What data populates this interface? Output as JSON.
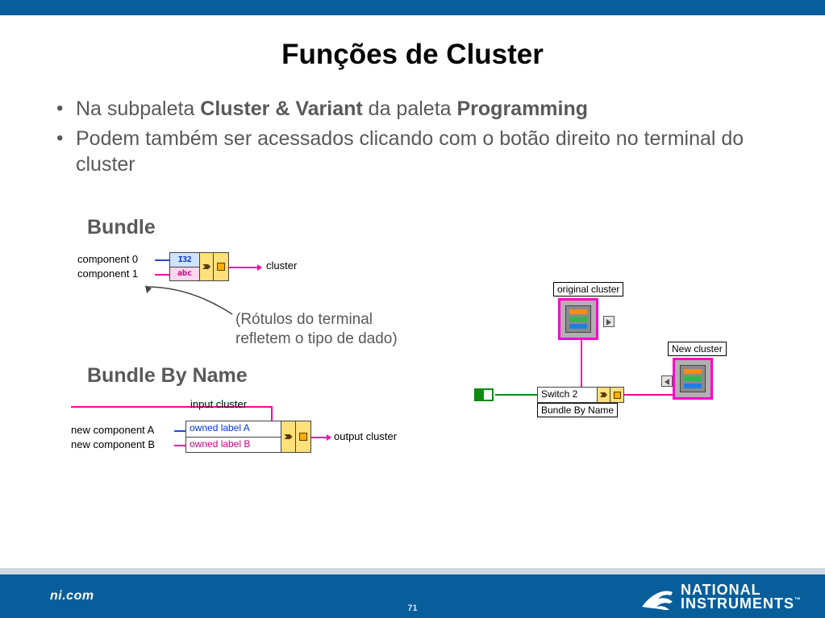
{
  "title": "Funções de Cluster",
  "bullets": {
    "b1": {
      "pre": "Na subpaleta ",
      "bold1": "Cluster & Variant",
      "mid": " da paleta ",
      "bold2": "Programming"
    },
    "b2": "Podem também ser acessados clicando com o botão direito no terminal do cluster"
  },
  "sections": {
    "bundle": "Bundle",
    "bbn": "Bundle By Name"
  },
  "note": {
    "l1": "(Rótulos do terminal",
    "l2": "refletem o tipo de dado)"
  },
  "diag1": {
    "c0": "component 0",
    "c1": "component 1",
    "cluster": "cluster",
    "t_top": "I32",
    "t_bot": "abc"
  },
  "diag2": {
    "inlabel": "input cluster",
    "ncA": "new component A",
    "ncB": "new component B",
    "labA": "owned label A",
    "labB": "owned label B",
    "outlabel": "output cluster"
  },
  "diag3": {
    "original": "original cluster",
    "newc": "New cluster",
    "switch": "Switch 2",
    "bbn": "Bundle By Name"
  },
  "footer": {
    "site": "ni.com",
    "page": "71",
    "brand1": "NATIONAL",
    "brand2": "INSTRUMENTS",
    "tm": "™"
  }
}
